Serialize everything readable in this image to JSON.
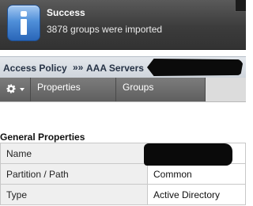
{
  "notification": {
    "title": "Success",
    "message": "3878 groups were imported",
    "icon": "info-icon"
  },
  "breadcrumb": {
    "items": [
      "Access Policy",
      "AAA Servers"
    ],
    "separator": "»»"
  },
  "tabs": {
    "gear_icon": "gear-icon",
    "items": [
      {
        "label": "Properties"
      },
      {
        "label": "Groups"
      }
    ]
  },
  "general_properties": {
    "title": "General Properties",
    "rows": [
      {
        "label": "Name",
        "value": ""
      },
      {
        "label": "Partition / Path",
        "value": "Common"
      },
      {
        "label": "Type",
        "value": "Active Directory"
      }
    ]
  },
  "colors": {
    "banner_bg": "#3c3c3c",
    "info_icon_blue": "#4f8fd9",
    "tab_bg": "#6b6b6b",
    "breadcrumb_bg": "#d6dbe1"
  }
}
